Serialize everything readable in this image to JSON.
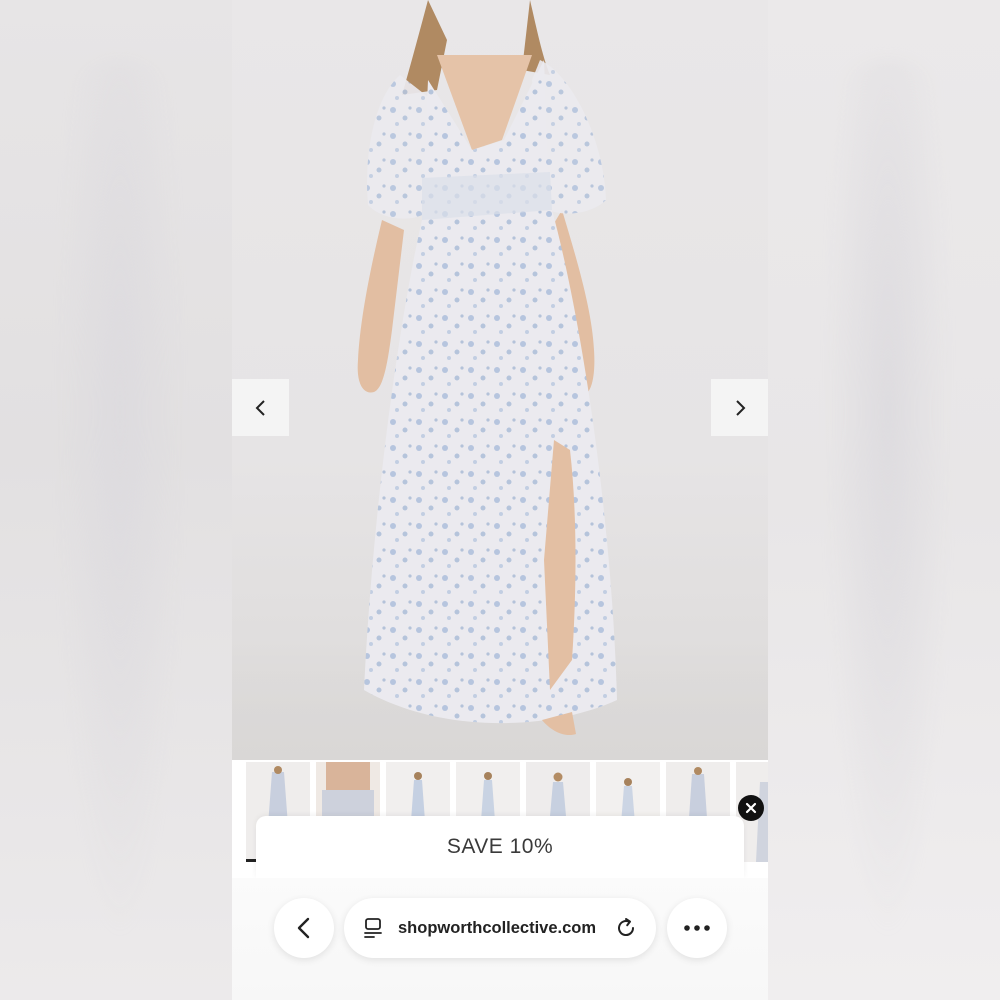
{
  "promo": {
    "label": "SAVE 10%"
  },
  "browser": {
    "url": "shopworthcollective.com",
    "icons": {
      "back": "chevron-left-icon",
      "tabs": "tab-view-icon",
      "reload": "reload-icon",
      "more": "more-dots-icon"
    }
  },
  "gallery": {
    "icons": {
      "prev": "chevron-left-icon",
      "next": "chevron-right-icon",
      "close": "close-icon"
    },
    "thumbnail_count": 8,
    "active_thumbnail": 1
  },
  "colors": {
    "dress_base": "#e9e8ee",
    "dress_print": "#9fb4d4",
    "backdrop": "#e7e5e6",
    "ui_dark": "#111111"
  }
}
